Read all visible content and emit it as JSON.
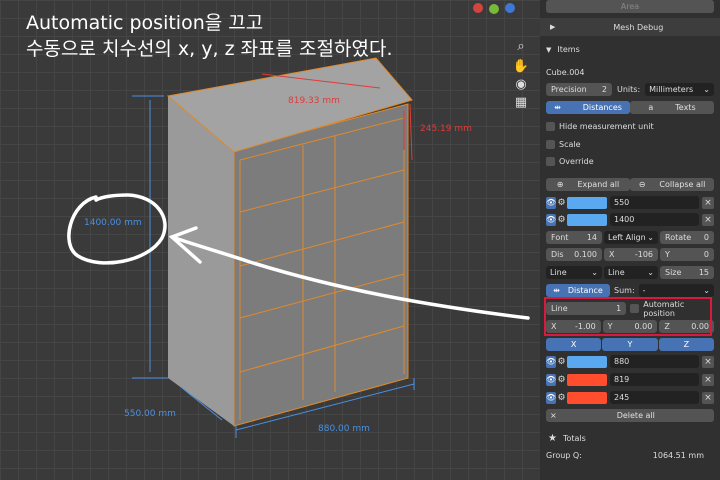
{
  "annotation": {
    "line1": "Automatic position을 끄고",
    "line2": "수동으로 치수선의 x, y, z 좌표를 조절하였다."
  },
  "dimensions": {
    "height": "1400.00 mm",
    "height_circled": "1400.00 mm",
    "depth": "550.00 mm",
    "width": "880.00 mm",
    "top_width": "819.33 mm",
    "top_height": "245.19 mm"
  },
  "colors": {
    "accent": "#4772b3",
    "highlight": "#d81b3c",
    "swatch_blue": "#5aa8f0",
    "swatch_red": "#ff4d2e"
  },
  "panel": {
    "area_tab": "Area",
    "mesh_debug": "Mesh Debug",
    "items_header": "Items",
    "object_name": "Cube.004",
    "precision_label": "Precision",
    "precision_value": "2",
    "units_label": "Units:",
    "units_value": "Millimeters",
    "distances_tab": "Distances",
    "texts_tab": "Texts",
    "hide_unit": "Hide measurement unit",
    "scale": "Scale",
    "override": "Override",
    "expand_all": "Expand all",
    "collapse_all": "Collapse all",
    "item1_value": "550",
    "item2_value": "1400",
    "font_label": "Font",
    "font_value": "14",
    "align_value": "Left Align",
    "rotate_label": "Rotate",
    "rotate_value": "0",
    "dis_label": "Dis",
    "dis_value": "0.100",
    "x_label": "X",
    "x_value": "-106",
    "y_label": "Y",
    "y_value": "0",
    "line_select_1": "Line",
    "line_select_2": "Line",
    "size_label": "Size",
    "size_value": "15",
    "distance_btn": "Distance",
    "sum_label": "Sum:",
    "sum_value": "-",
    "line_label": "Line",
    "line_value": "1",
    "auto_position": "Automatic position",
    "pos_x_label": "X",
    "pos_x_value": "-1.00",
    "pos_y_label": "Y",
    "pos_y_value": "0.00",
    "pos_z_label": "Z",
    "pos_z_value": "0.00",
    "axis_x": "X",
    "axis_y": "Y",
    "axis_z": "Z",
    "item3_value": "880",
    "item4_value": "819",
    "item5_value": "245",
    "delete_all": "Delete all",
    "totals_header": "Totals",
    "group_label": "Group Q:",
    "group_value": "1064.51 mm"
  }
}
